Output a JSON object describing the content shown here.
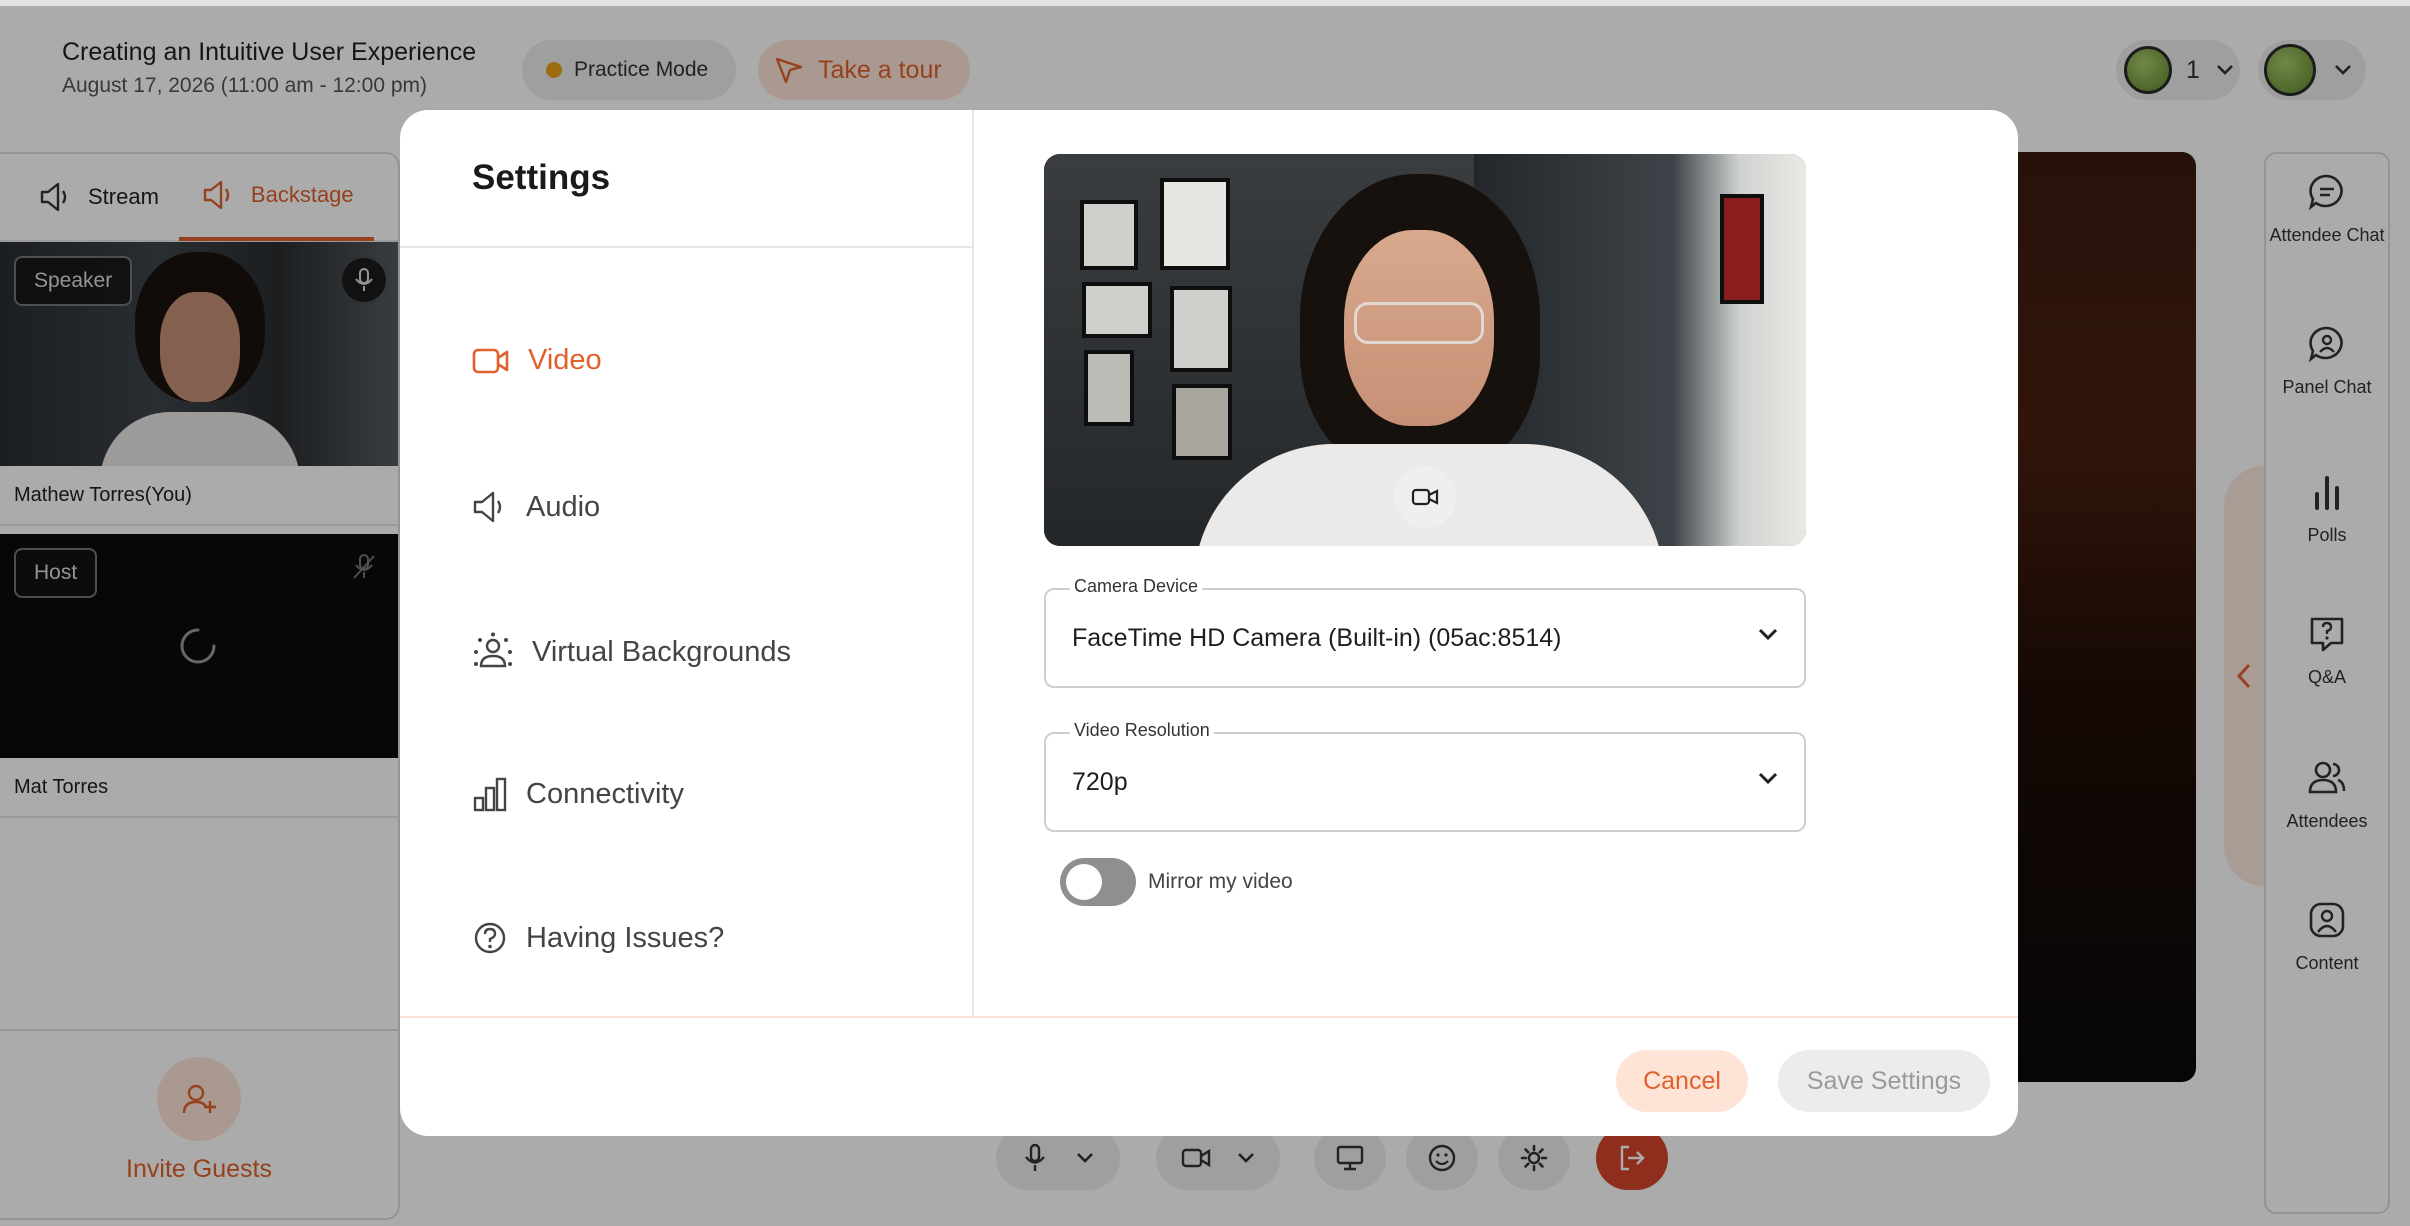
{
  "event": {
    "title": "Creating an Intuitive User Experience",
    "date": "August 17, 2026 (11:00 am - 12:00 pm)",
    "practice_label": "Practice Mode",
    "tour_label": "Take a tour",
    "presence_count": "1"
  },
  "sidebar": {
    "tabs": [
      {
        "label": "Stream",
        "icon": "speaker-icon"
      },
      {
        "label": "Backstage",
        "icon": "speaker-icon",
        "active": true
      }
    ],
    "participants": [
      {
        "badge": "Speaker",
        "name": "Mathew Torres(You)",
        "mic": "mic-on-icon"
      },
      {
        "badge": "Host",
        "name": "Mat Torres",
        "mic": "mic-off-icon"
      }
    ],
    "invite_label": "Invite Guests"
  },
  "rail": {
    "items": [
      {
        "label": "Attendee Chat",
        "icon": "chat-icon"
      },
      {
        "label": "Panel Chat",
        "icon": "panel-chat-icon"
      },
      {
        "label": "Polls",
        "icon": "polls-icon"
      },
      {
        "label": "Q&A",
        "icon": "qa-icon"
      },
      {
        "label": "Attendees",
        "icon": "attendees-icon"
      },
      {
        "label": "Content",
        "icon": "content-icon"
      }
    ]
  },
  "settings": {
    "title": "Settings",
    "nav": [
      {
        "label": "Video",
        "icon": "video-icon",
        "active": true
      },
      {
        "label": "Audio",
        "icon": "speaker-icon"
      },
      {
        "label": "Virtual Backgrounds",
        "icon": "virtual-bg-icon"
      },
      {
        "label": "Connectivity",
        "icon": "signal-bars-icon"
      },
      {
        "label": "Having Issues?",
        "icon": "help-icon"
      }
    ],
    "camera_device": {
      "label": "Camera Device",
      "value": "FaceTime HD Camera (Built-in) (05ac:8514)"
    },
    "video_resolution": {
      "label": "Video Resolution",
      "value": "720p"
    },
    "mirror": {
      "label": "Mirror my video",
      "enabled": false
    },
    "cancel_label": "Cancel",
    "save_label": "Save Settings"
  },
  "colors": {
    "accent": "#e0612c",
    "accent_light": "#fde4d7",
    "practice_dot": "#e8a21a",
    "leave": "#d6452a"
  }
}
